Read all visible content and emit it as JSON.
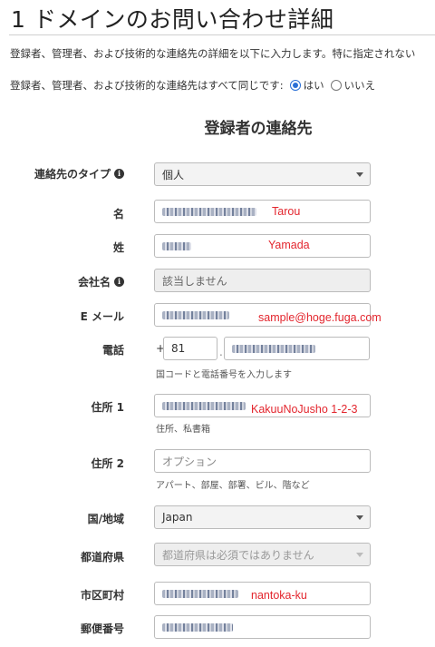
{
  "header": {
    "title": "1 ドメインのお問い合わせ詳細",
    "intro": "登録者、管理者、および技術的な連絡先の詳細を以下に入力します。特に指定されない"
  },
  "same_contacts": {
    "question": "登録者、管理者、および技術的な連絡先はすべて同じです:",
    "yes": "はい",
    "no": "いいえ",
    "selected": "はい"
  },
  "section": {
    "heading": "登録者の連絡先"
  },
  "form": {
    "contact_type": {
      "label": "連絡先のタイプ",
      "value": "個人"
    },
    "first_name": {
      "label": "名",
      "overlay": "Tarou"
    },
    "last_name": {
      "label": "姓",
      "overlay": "Yamada"
    },
    "company": {
      "label": "会社名",
      "value": "該当しません"
    },
    "email": {
      "label": "E メール",
      "overlay": "sample@hoge.fuga.com"
    },
    "phone": {
      "label": "電話",
      "prefix": "+",
      "country_code": "81",
      "separator": ".",
      "hint": "国コードと電話番号を入力します"
    },
    "address1": {
      "label": "住所 1",
      "overlay": "KakuuNoJusho 1-2-3",
      "hint": "住所、私書箱"
    },
    "address2": {
      "label": "住所 2",
      "placeholder": "オプション",
      "hint": "アパート、部屋、部署、ビル、階など"
    },
    "country": {
      "label": "国/地域",
      "value": "Japan"
    },
    "prefecture": {
      "label": "都道府県",
      "value": "都道府県は必須ではありません"
    },
    "city": {
      "label": "市区町村",
      "overlay": "nantoka-ku"
    },
    "postal": {
      "label": "郵便番号"
    }
  },
  "colors": {
    "annotation_red": "#e3262e",
    "radio_blue": "#2a6fd6"
  },
  "icons": {
    "info": "info-circle-icon",
    "dropdown": "chevron-down-icon"
  }
}
